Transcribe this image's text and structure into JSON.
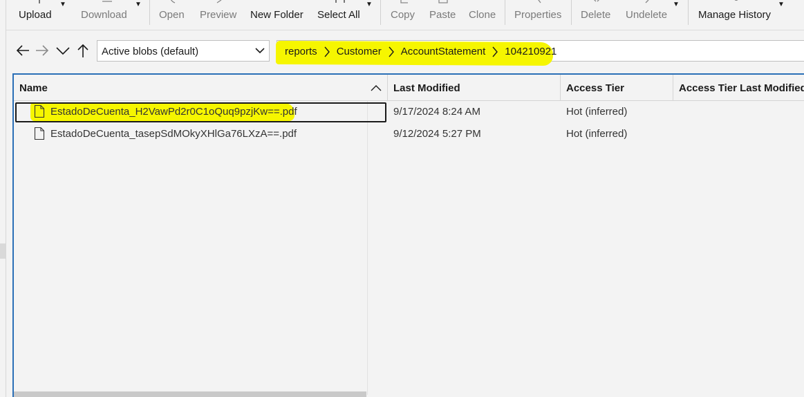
{
  "toolbar": {
    "upload": "Upload",
    "download": "Download",
    "open": "Open",
    "preview": "Preview",
    "new_folder": "New Folder",
    "select_all": "Select All",
    "copy": "Copy",
    "paste": "Paste",
    "clone": "Clone",
    "properties": "Properties",
    "delete": "Delete",
    "undelete": "Undelete",
    "manage_history": "Manage History"
  },
  "nav": {
    "view_select": "Active blobs (default)",
    "breadcrumb": [
      "reports",
      "Customer",
      "AccountStatement",
      "104210921"
    ]
  },
  "list": {
    "columns": [
      "Name",
      "Last Modified",
      "Access Tier",
      "Access Tier Last Modified"
    ],
    "rows": [
      {
        "name": "EstadoDeCuenta_H2VawPd2r0C1oQuq9pzjKw==.pdf",
        "modified": "9/17/2024 8:24 AM",
        "tier": "Hot (inferred)",
        "tier_modified": ""
      },
      {
        "name": "EstadoDeCuenta_tasepSdMOkyXHlGa76LXzA==.pdf",
        "modified": "9/12/2024 5:27 PM",
        "tier": "Hot (inferred)",
        "tier_modified": ""
      }
    ]
  },
  "colors": {
    "highlight": "#f6f600",
    "focus_border": "#2a6fb7"
  }
}
